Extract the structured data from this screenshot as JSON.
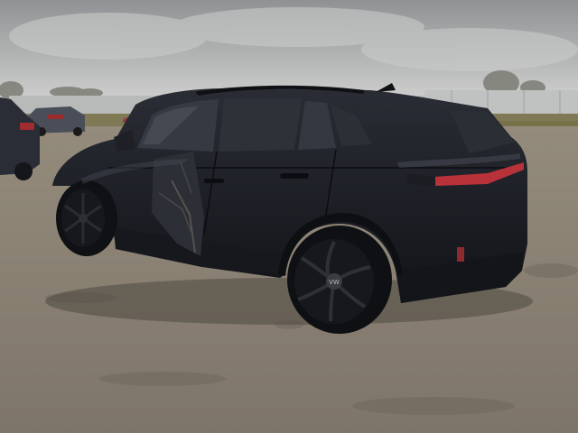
{
  "scene": {
    "subject": "car",
    "palette": {
      "sky_top": "#8f9294",
      "sky_bottom": "#d3d4d2",
      "ground": "#8a8174",
      "ground_dark": "#6f675c",
      "grass": "#7f7a52",
      "fence": "#b9bcbc",
      "car_body": "#1b1d23",
      "car_highlight": "#3a3d46",
      "window": "#2a2f36",
      "taillight": "#b8323a",
      "wheel_rim": "#16171a"
    },
    "vehicle_badge": "VW"
  }
}
